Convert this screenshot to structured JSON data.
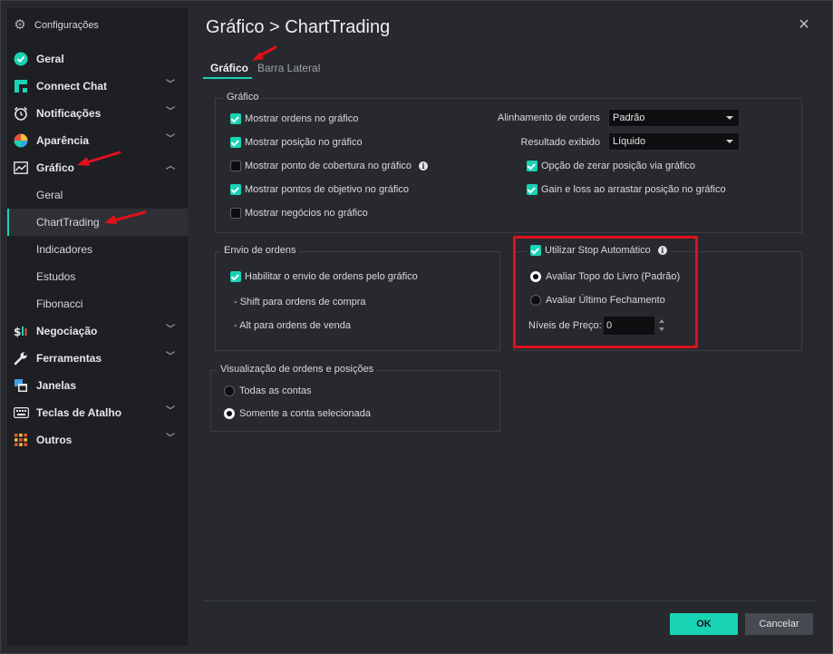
{
  "window": {
    "title": "Configurações",
    "breadcrumb": "Gráfico > ChartTrading",
    "close_icon": "close-icon"
  },
  "sidebar": {
    "items": [
      {
        "label": "Geral",
        "icon": "check-circle-icon"
      },
      {
        "label": "Connect Chat",
        "icon": "chat-icon"
      },
      {
        "label": "Notificações",
        "icon": "alarm-clock-icon"
      },
      {
        "label": "Aparência",
        "icon": "palette-icon"
      },
      {
        "label": "Gráfico",
        "icon": "chart-icon"
      },
      {
        "label": "Negociação",
        "icon": "trade-icon"
      },
      {
        "label": "Ferramentas",
        "icon": "wrench-icon"
      },
      {
        "label": "Janelas",
        "icon": "windows-icon"
      },
      {
        "label": "Teclas de Atalho",
        "icon": "keyboard-icon"
      },
      {
        "label": "Outros",
        "icon": "grid-icon"
      }
    ],
    "sub_items": [
      "Geral",
      "ChartTrading",
      "Indicadores",
      "Estudos",
      "Fibonacci"
    ]
  },
  "tabs": [
    {
      "label": "Gráfico",
      "active": true
    },
    {
      "label": "Barra Lateral",
      "active": false
    }
  ],
  "grafico_group": {
    "title": "Gráfico",
    "checkboxes": [
      {
        "label": "Mostrar ordens no gráfico",
        "checked": true
      },
      {
        "label": "Mostrar posição no gráfico",
        "checked": true
      },
      {
        "label": "Mostrar ponto de cobertura no gráfico",
        "checked": false
      },
      {
        "label": "Mostrar pontos de objetivo no gráfico",
        "checked": true
      },
      {
        "label": "Mostrar negócios no gráfico",
        "checked": false
      }
    ],
    "alinhamento_label": "Alinhamento de ordens",
    "alinhamento_value": "Padrão",
    "resultado_label": "Resultado exibido",
    "resultado_value": "Líquido",
    "right_checkboxes": [
      {
        "label": "Opção de zerar posição via gráfico",
        "checked": true
      },
      {
        "label": "Gain e loss ao arrastar posição no gráfico",
        "checked": true
      }
    ]
  },
  "envio_group": {
    "title": "Envio de ordens",
    "checkbox": {
      "label": "Habilitar o envio de ordens pelo gráfico",
      "checked": true
    },
    "hint_buy": "- Shift para ordens de compra",
    "hint_sell": "- Alt para ordens de venda"
  },
  "stop_group": {
    "title": "Utilizar Stop Automático",
    "checked": true,
    "radio_1": "Avaliar Topo do Livro (Padrão)",
    "radio_2": "Avaliar Último Fechamento",
    "selected": 1,
    "niveis_label": "Níveis de Preço:",
    "niveis_value": "0"
  },
  "visualizacao_group": {
    "title": "Visualização de ordens e posições",
    "radio_1": "Todas as contas",
    "radio_2": "Somente a conta selecionada",
    "selected": 2
  },
  "footer": {
    "ok_label": "OK",
    "cancel_label": "Cancelar"
  },
  "colors": {
    "accent": "#19d3b5",
    "highlight_box": "#e0101a",
    "background": "#27292e",
    "sidebar": "#1d1f23"
  }
}
